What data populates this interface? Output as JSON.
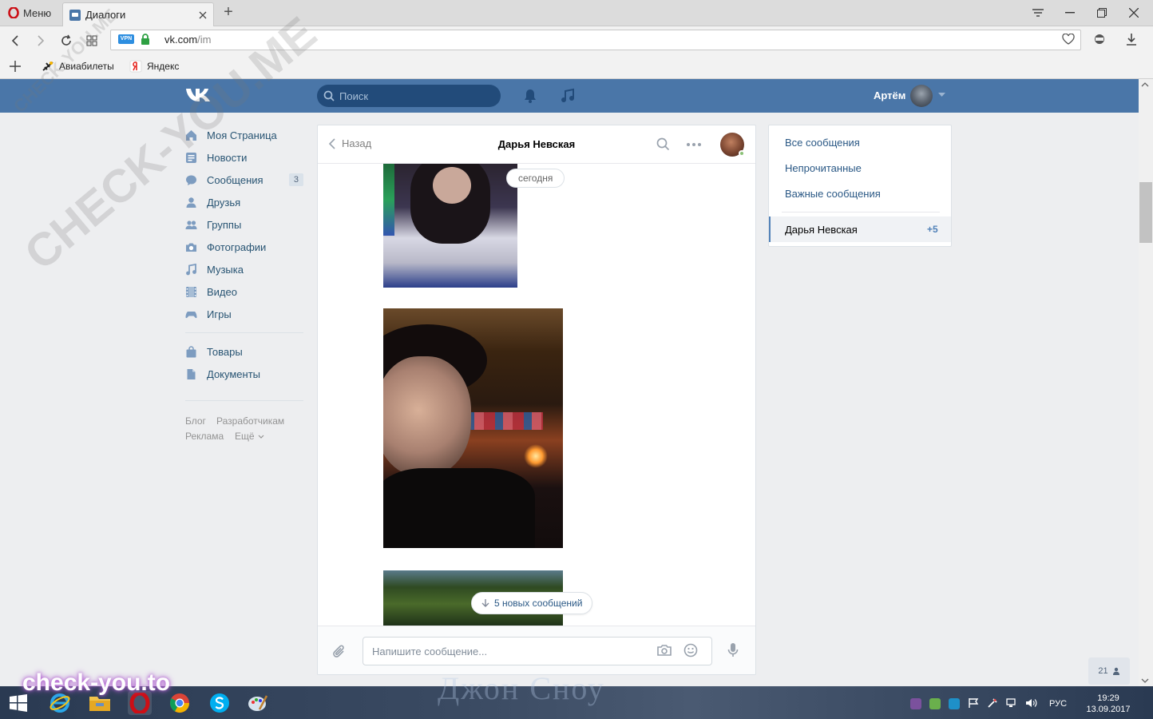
{
  "browser": {
    "menu_label": "Меню",
    "tab_title": "Диалоги",
    "url_host": "vk.com",
    "url_path": "/im",
    "vpn_badge": "VPN",
    "bookmarks": [
      "Авиабилеты",
      "Яндекс"
    ]
  },
  "vk_header": {
    "search_placeholder": "Поиск",
    "user_name": "Артём"
  },
  "left_nav": {
    "items": [
      {
        "label": "Моя Страница",
        "icon": "home-icon"
      },
      {
        "label": "Новости",
        "icon": "news-icon"
      },
      {
        "label": "Сообщения",
        "icon": "messages-icon",
        "badge": "3"
      },
      {
        "label": "Друзья",
        "icon": "friends-icon"
      },
      {
        "label": "Группы",
        "icon": "groups-icon"
      },
      {
        "label": "Фотографии",
        "icon": "camera-icon"
      },
      {
        "label": "Музыка",
        "icon": "music-note-icon"
      },
      {
        "label": "Видео",
        "icon": "film-icon"
      },
      {
        "label": "Игры",
        "icon": "gamepad-icon"
      },
      {
        "label": "Товары",
        "icon": "bag-icon"
      },
      {
        "label": "Документы",
        "icon": "document-icon"
      }
    ],
    "footer": [
      "Блог",
      "Разработчикам",
      "Реклама",
      "Ещё"
    ]
  },
  "chat": {
    "back_label": "Назад",
    "title": "Дарья Невская",
    "date_label": "сегодня",
    "new_messages_label": "5 новых сообщений",
    "input_placeholder": "Напишите сообщение..."
  },
  "right_panel": {
    "links": [
      "Все сообщения",
      "Непрочитанные",
      "Важные сообщения"
    ],
    "active_dialog": {
      "name": "Дарья Невская",
      "count": "+5"
    }
  },
  "online_count": "21",
  "watermarks": [
    "CHECK-YOU.ME",
    "CHECK-YOU.ME",
    "check-you.to",
    "Джон Сноу"
  ],
  "taskbar": {
    "lang": "РУС",
    "time": "19:29",
    "date": "13.09.2017"
  },
  "colors": {
    "vk_blue": "#4a76a8",
    "link": "#2a5885",
    "nav_text": "#285473",
    "page_bg": "#edeef0"
  }
}
